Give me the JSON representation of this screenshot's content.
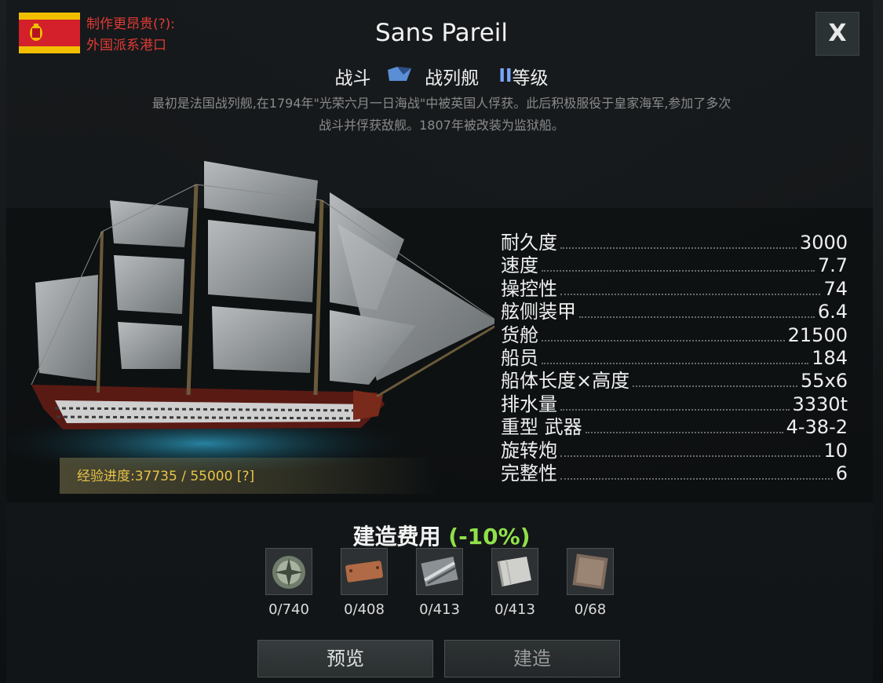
{
  "header": {
    "origin_line1": "制作更昂贵(?):",
    "origin_line2": "外国派系港口",
    "title": "Sans Pareil",
    "close_label": "X"
  },
  "ship": {
    "role": "战斗",
    "type": "战列舰",
    "rank_mark": "II",
    "rank_label": "等级",
    "description_line1": "最初是法国战列舰,在1794年\"光荣六月一日海战\"中被英国人俘获。此后积极服役于皇家海军,参加了多次",
    "description_line2": "战斗并俘获敌舰。1807年被改装为监狱船。"
  },
  "stats": [
    {
      "label": "耐久度",
      "value": "3000"
    },
    {
      "label": "速度",
      "value": "7.7"
    },
    {
      "label": "操控性",
      "value": "74"
    },
    {
      "label": "舷侧装甲",
      "value": "6.4"
    },
    {
      "label": "货舱",
      "value": "21500"
    },
    {
      "label": "船员",
      "value": "184"
    },
    {
      "label": "船体长度×高度",
      "value": "55x6"
    },
    {
      "label": "排水量",
      "value": "3330t"
    },
    {
      "label": "重型 武器",
      "value": "4-38-2"
    },
    {
      "label": "旋转炮",
      "value": "10"
    },
    {
      "label": "完整性",
      "value": "6"
    }
  ],
  "experience": {
    "text": "经验进度:37735  /  55000 [?]"
  },
  "cost": {
    "title": "建造费用",
    "discount": "(-10%)",
    "materials": [
      {
        "icon": "compass-medallion-icon",
        "count": "0/740"
      },
      {
        "icon": "copper-plate-icon",
        "count": "0/408"
      },
      {
        "icon": "iron-plate-icon",
        "count": "0/413"
      },
      {
        "icon": "canvas-cloth-icon",
        "count": "0/413"
      },
      {
        "icon": "wood-plank-icon",
        "count": "0/68"
      }
    ]
  },
  "buttons": {
    "preview": "预览",
    "build": "建造"
  },
  "colors": {
    "origin_red": "#e03a35",
    "discount_green": "#8fe04a",
    "exp_gold": "#e7c44a",
    "rank_blue": "#7aa7ff"
  }
}
